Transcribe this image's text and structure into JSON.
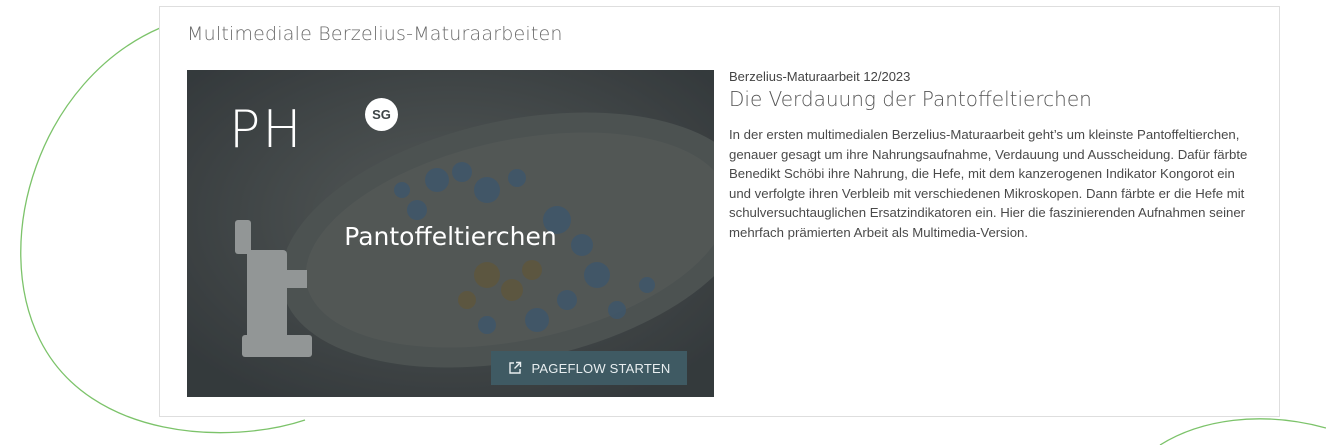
{
  "section": {
    "title": "Multimediale Berzelius-Maturaarbeiten"
  },
  "media": {
    "logo_text": "PH",
    "logo_badge": "SG",
    "overlay_title": "Pantoffeltierchen",
    "button_label": "PAGEFLOW STARTEN",
    "button_icon": "external-link-icon"
  },
  "article": {
    "kicker": "Berzelius-Maturaarbeit 12/2023",
    "headline": "Die Verdauung der Pantoffeltierchen",
    "description": "In der ersten multimedialen Berzelius-Maturaarbeit geht’s um kleinste Pantoffeltierchen, genauer gesagt um ihre Nahrungsaufnahme, Verdauung und Ausscheidung. Dafür färbte Benedikt Schöbi ihre Nahrung, die Hefe, mit dem kanzerogenen Indikator Kongorot ein und verfolgte ihren Verbleib mit verschiedenen Mikroskopen. Dann färbte er die Hefe mit schulversuchtauglichen Ersatzindikatoren ein. Hier die faszinierenden Aufnahmen seiner mehrfach prämierten Arbeit als Multimedia-Version."
  },
  "colors": {
    "accent_line": "#7cc36a",
    "button_bg": "#3f5a63",
    "card_border": "#dedede"
  }
}
